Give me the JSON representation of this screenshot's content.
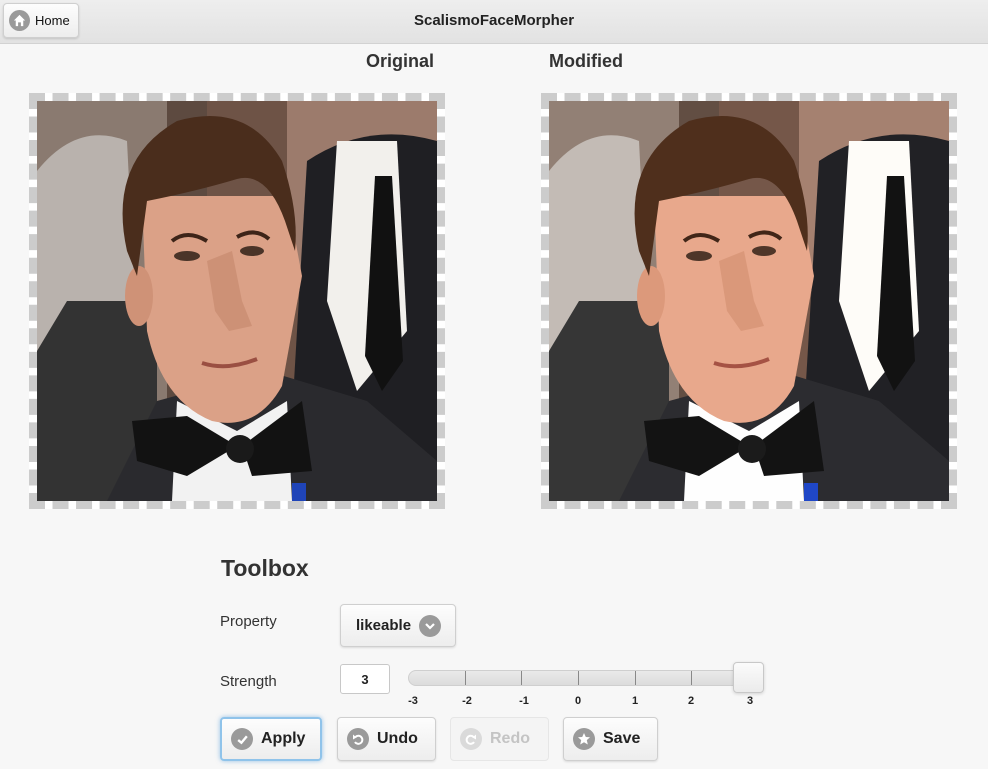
{
  "app": {
    "title": "ScalismoFaceMorpher"
  },
  "header": {
    "home_label": "Home"
  },
  "images": {
    "original_title": "Original",
    "modified_title": "Modified"
  },
  "toolbox": {
    "title": "Toolbox",
    "property_label": "Property",
    "property_value": "likeable",
    "strength_label": "Strength",
    "strength_value": "3",
    "slider": {
      "min": -3,
      "max": 3,
      "value": 3,
      "tick_labels": [
        "-3",
        "-2",
        "-1",
        "0",
        "1",
        "2",
        "3"
      ]
    },
    "buttons": {
      "apply": "Apply",
      "undo": "Undo",
      "redo": "Redo",
      "save": "Save"
    }
  },
  "colors": {
    "accent_focus": "#8fc3ea",
    "icon_gray": "#9a9a9a",
    "disabled_text": "#c4c4c4"
  }
}
